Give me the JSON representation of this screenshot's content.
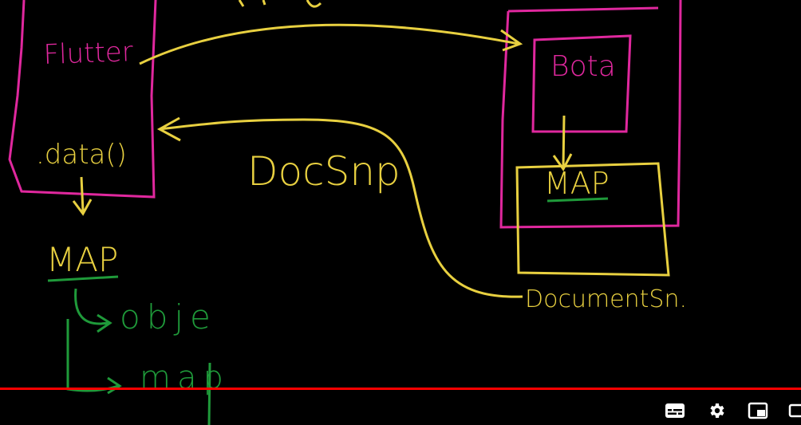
{
  "colors": {
    "background": "#000000",
    "magenta": "#e0289e",
    "yellow": "#e8d040",
    "green": "#1f9a3a",
    "progress_red": "#ff0000",
    "icon_white": "#ffffff"
  },
  "whiteboard": {
    "flutter_label": "Flutter",
    "data_call_label": ".data()",
    "map_left_label": "MAP",
    "obje_label": "obje",
    "map_small_label": "map",
    "docsnp_label": "DocSnp",
    "bota_label": "Bota",
    "map_right_label": "MAP",
    "documentsn_label": "DocumentSn."
  },
  "player": {
    "progress": 1.0,
    "controls": [
      {
        "name": "subtitles-icon"
      },
      {
        "name": "settings-gear-icon"
      },
      {
        "name": "miniplayer-icon"
      },
      {
        "name": "theater-mode-icon"
      }
    ]
  }
}
